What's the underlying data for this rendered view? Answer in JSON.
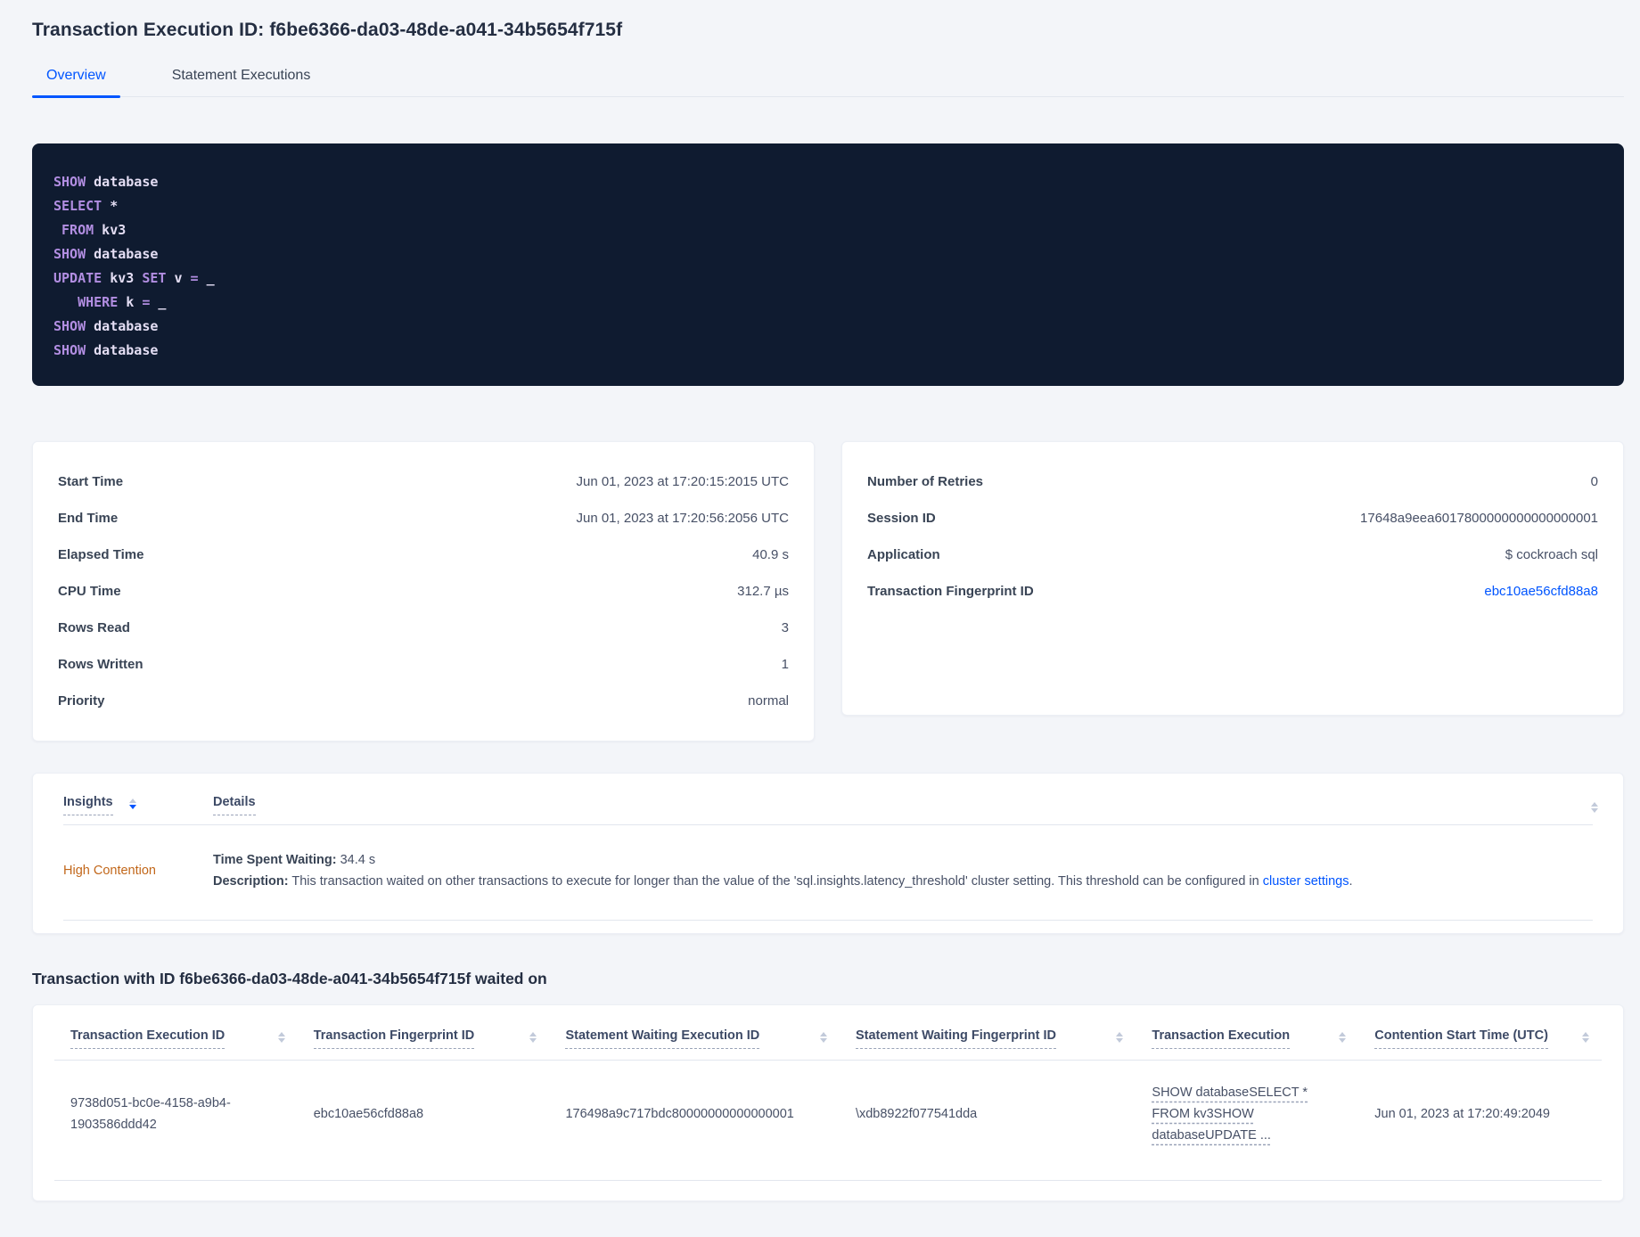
{
  "colors": {
    "accent_blue": "#0055ff",
    "insight_orange": "#c2671a",
    "code_background": "#0f1b30",
    "code_keyword": "#b28ee2",
    "code_identifier": "#e4def4"
  },
  "page": {
    "title": "Transaction Execution ID: f6be6366-da03-48de-a041-34b5654f715f",
    "tabs": [
      {
        "label": "Overview",
        "active": true
      },
      {
        "label": "Statement Executions",
        "active": false
      }
    ]
  },
  "sql": {
    "line1": {
      "a": "SHOW",
      "b": " database"
    },
    "line2": {
      "a": "SELECT",
      "b": " *"
    },
    "line3": {
      "a": " FROM",
      "b": " kv3"
    },
    "line4": {
      "a": "SHOW",
      "b": " database"
    },
    "line5": {
      "a": "UPDATE",
      "b": " kv3 ",
      "c": "SET",
      "d": " v ",
      "e": "=",
      "f": " _"
    },
    "line6": {
      "a": "   WHERE",
      "b": " k ",
      "c": "=",
      "d": " _"
    },
    "line7": {
      "a": "SHOW",
      "b": " database"
    },
    "line8": {
      "a": "SHOW",
      "b": " database"
    }
  },
  "details_left": {
    "rows": [
      {
        "label": "Start Time",
        "value": "Jun 01, 2023 at 17:20:15:2015 UTC"
      },
      {
        "label": "End Time",
        "value": "Jun 01, 2023 at 17:20:56:2056 UTC"
      },
      {
        "label": "Elapsed Time",
        "value": "40.9 s"
      },
      {
        "label": "CPU Time",
        "value": "312.7 µs"
      },
      {
        "label": "Rows Read",
        "value": "3"
      },
      {
        "label": "Rows Written",
        "value": "1"
      },
      {
        "label": "Priority",
        "value": "normal"
      }
    ]
  },
  "details_right": {
    "rows": [
      {
        "label": "Number of Retries",
        "value": "0"
      },
      {
        "label": "Session ID",
        "value": "17648a9eea6017800000000000000001"
      },
      {
        "label": "Application",
        "value": "$ cockroach sql"
      },
      {
        "label": "Transaction Fingerprint ID",
        "value": "ebc10ae56cfd88a8"
      }
    ]
  },
  "insights": {
    "columns": [
      "Insights",
      "Details"
    ],
    "row": {
      "insight": "High Contention",
      "waiting_label": "Time Spent Waiting:",
      "waiting_value": " 34.4 s",
      "description_label": "Description:",
      "description_text": " This transaction waited on other transactions to execute for longer than the value of the 'sql.insights.latency_threshold' cluster setting. This threshold can be configured in ",
      "description_link": "cluster settings",
      "description_period": "."
    }
  },
  "waited": {
    "heading": "Transaction with ID f6be6366-da03-48de-a041-34b5654f715f waited on",
    "columns": [
      "Transaction Execution ID",
      "Transaction Fingerprint ID",
      "Statement Waiting Execution ID",
      "Statement Waiting Fingerprint ID",
      "Transaction Execution",
      "Contention Start Time (UTC)"
    ],
    "row": {
      "txn_execution_id": "9738d051-bc0e-4158-a9b4-1903586ddd42",
      "txn_fingerprint_id": "ebc10ae56cfd88a8",
      "stmt_waiting_execution_id": "176498a9c717bdc80000000000000001",
      "stmt_waiting_fingerprint_id": "\\xdb8922f077541dda",
      "txn_execution": "SHOW databaseSELECT * FROM kv3SHOW databaseUPDATE ...",
      "contention_start": "Jun 01, 2023 at 17:20:49:2049"
    }
  }
}
